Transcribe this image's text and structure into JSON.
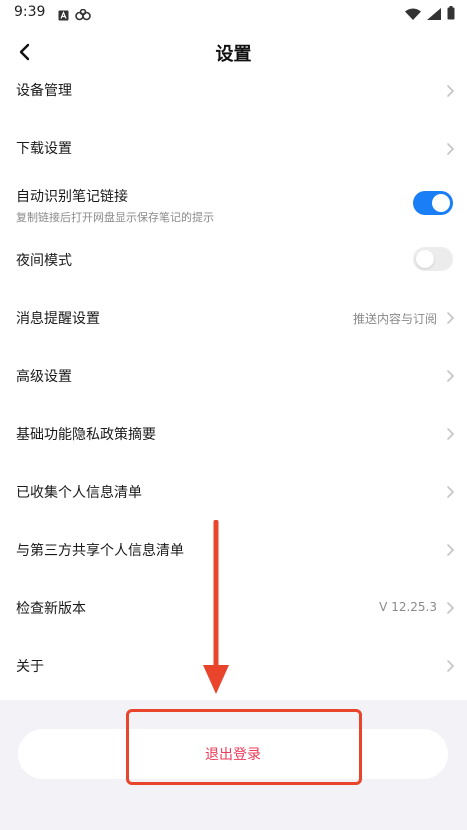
{
  "status_bar": {
    "time": "9:39",
    "left_icons": [
      "app-a-icon",
      "link-icon"
    ],
    "right_icons": [
      "wifi-icon",
      "signal-icon",
      "battery-icon"
    ]
  },
  "header": {
    "title": "设置",
    "back_icon": "chevron-left-icon"
  },
  "settings": {
    "device_management": "设备管理",
    "download_settings": "下载设置",
    "auto_detect_title": "自动识别笔记链接",
    "auto_detect_subtitle": "复制链接后打开网盘显示保存笔记的提示",
    "auto_detect_enabled": true,
    "night_mode": "夜间模式",
    "night_mode_enabled": false,
    "notification_settings": "消息提醒设置",
    "notification_value": "推送内容与订阅",
    "advanced_settings": "高级设置",
    "privacy_summary": "基础功能隐私政策摘要",
    "collected_info": "已收集个人信息清单",
    "shared_info": "与第三方共享个人信息清单",
    "check_update": "检查新版本",
    "version": "V 12.25.3",
    "about": "关于"
  },
  "footer": {
    "logout_label": "退出登录"
  },
  "colors": {
    "accent_blue": "#1a7ef7",
    "logout_red": "#ef3b5a",
    "annotation_red": "#e8452c",
    "footer_bg": "#f3f3f7"
  }
}
